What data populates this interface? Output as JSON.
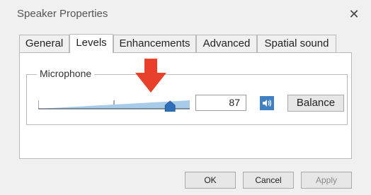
{
  "window": {
    "title": "Speaker Properties"
  },
  "tabs": [
    {
      "label": "General",
      "active": false
    },
    {
      "label": "Levels",
      "active": true
    },
    {
      "label": "Enhancements",
      "active": false
    },
    {
      "label": "Advanced",
      "active": false
    },
    {
      "label": "Spatial sound",
      "active": false
    }
  ],
  "levels": {
    "group_label": "Microphone",
    "level_value": "87",
    "level_fraction": 0.87,
    "balance_label": "Balance",
    "speaker_icon": "speaker-icon"
  },
  "annotation": {
    "arrow_color": "#e8402a",
    "icon": "arrow-down-icon"
  },
  "footer": {
    "ok_label": "OK",
    "cancel_label": "Cancel",
    "apply_label": "Apply"
  },
  "colors": {
    "accent": "#3f7fc4",
    "slider_fill": "#a9cbea"
  }
}
